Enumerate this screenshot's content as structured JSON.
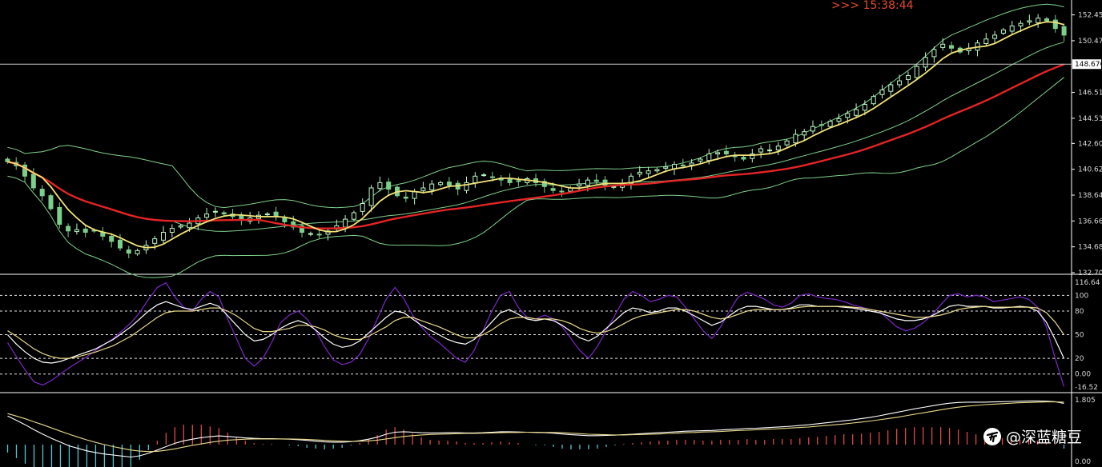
{
  "header": {
    "countdown": ">>> 15:38:44"
  },
  "watermark": {
    "icon": "toutiao-logo-icon",
    "text": "@深蓝糖豆"
  },
  "colors": {
    "background": "#000000",
    "bull_candle": "#b9f7c3",
    "bear_candle": "#7ccf8a",
    "bollinger": "#7fd08a",
    "ma_fast": "#f2e27a",
    "ma_slow": "#e32424",
    "grid": "#e6e6e6",
    "kdj_j": "#7b28c8",
    "kdj_k": "#ffffff",
    "kdj_d": "#e9d98a",
    "macd_pos": "#e04646",
    "macd_neg": "#4fc7d2",
    "countdown": "#e34a2c"
  },
  "chart_data": [
    {
      "type": "candlestick",
      "title": "",
      "ylim": [
        132.705,
        153.1
      ],
      "yticks": [
        "152.450",
        "150.470",
        "146.510",
        "144.530",
        "142.605",
        "140.625",
        "138.645",
        "136.665",
        "134.685",
        "132.705"
      ],
      "current_price": "148.676",
      "grid": false,
      "overlays": [
        "bollinger_upper",
        "bollinger_middle",
        "bollinger_lower",
        "ma_fast",
        "ma_slow"
      ],
      "close_series": [
        141.2,
        140.9,
        140.1,
        139.2,
        138.6,
        137.6,
        136.4,
        135.9,
        136.0,
        135.8,
        135.9,
        135.5,
        135.1,
        134.6,
        134.2,
        134.4,
        134.8,
        135.3,
        135.8,
        136.1,
        136.3,
        136.5,
        136.9,
        137.2,
        137.4,
        137.2,
        137.0,
        136.8,
        136.9,
        137.1,
        137.2,
        137.0,
        136.6,
        136.2,
        135.8,
        135.7,
        135.6,
        135.9,
        136.3,
        136.8,
        137.3,
        138.0,
        139.2,
        139.6,
        139.1,
        138.6,
        138.4,
        138.9,
        139.2,
        139.5,
        139.6,
        139.4,
        139.1,
        139.6,
        140.1,
        140.2,
        140.0,
        139.8,
        139.6,
        139.7,
        139.9,
        139.6,
        139.3,
        139.0,
        138.9,
        139.2,
        139.5,
        139.8,
        139.7,
        139.4,
        139.3,
        139.5,
        140.1,
        140.4,
        140.5,
        140.6,
        140.8,
        141.0,
        140.9,
        141.1,
        141.4,
        141.8,
        141.9,
        141.8,
        141.6,
        141.4,
        141.8,
        142.2,
        142.1,
        142.4,
        142.8,
        143.3,
        143.5,
        143.9,
        144.0,
        144.3,
        144.5,
        144.9,
        145.2,
        145.6,
        146.2,
        146.7,
        147.1,
        147.4,
        147.8,
        148.5,
        149.2,
        149.8,
        150.2,
        149.9,
        149.6,
        149.9,
        150.3,
        150.6,
        150.9,
        151.3,
        151.6,
        151.8,
        152.0,
        152.2,
        152.0,
        151.4,
        150.9
      ]
    },
    {
      "type": "line",
      "title": "",
      "ylim": [
        -16.52,
        116.64
      ],
      "yticks": [
        "116.64",
        "100",
        "80",
        "50",
        "20",
        "0.00",
        "-16.52"
      ],
      "levels": [
        100,
        80,
        50,
        20,
        0
      ],
      "series": [
        {
          "key": "J",
          "color": "#7b28c8",
          "values": [
            40,
            22,
            5,
            -10,
            -14,
            -8,
            0,
            8,
            15,
            22,
            30,
            38,
            45,
            55,
            65,
            78,
            95,
            110,
            116,
            98,
            85,
            80,
            95,
            105,
            98,
            70,
            45,
            20,
            10,
            20,
            40,
            65,
            75,
            80,
            70,
            55,
            35,
            18,
            12,
            15,
            25,
            45,
            70,
            95,
            110,
            96,
            75,
            60,
            48,
            40,
            30,
            20,
            15,
            30,
            55,
            80,
            100,
            105,
            85,
            72,
            70,
            75,
            70,
            60,
            45,
            30,
            20,
            35,
            55,
            75,
            95,
            105,
            100,
            92,
            95,
            100,
            98,
            85,
            70,
            55,
            45,
            60,
            80,
            98,
            104,
            100,
            95,
            88,
            85,
            90,
            100,
            102,
            98,
            96,
            95,
            92,
            88,
            85,
            82,
            80,
            70,
            60,
            55,
            58,
            65,
            75,
            88,
            100,
            102,
            98,
            100,
            98,
            92,
            94,
            96,
            98,
            95,
            85,
            60,
            20,
            -16
          ]
        },
        {
          "key": "K",
          "color": "#ffffff",
          "values": [
            50,
            38,
            28,
            20,
            15,
            14,
            16,
            20,
            24,
            28,
            32,
            38,
            44,
            52,
            60,
            70,
            80,
            88,
            92,
            88,
            84,
            82,
            86,
            90,
            86,
            74,
            62,
            50,
            42,
            44,
            50,
            58,
            64,
            68,
            64,
            56,
            46,
            38,
            34,
            36,
            42,
            52,
            62,
            72,
            80,
            78,
            70,
            62,
            56,
            50,
            44,
            40,
            38,
            44,
            54,
            66,
            78,
            82,
            76,
            70,
            68,
            70,
            68,
            62,
            54,
            46,
            42,
            48,
            58,
            68,
            78,
            84,
            82,
            78,
            80,
            84,
            84,
            80,
            74,
            68,
            62,
            66,
            74,
            82,
            86,
            86,
            84,
            82,
            82,
            84,
            88,
            88,
            86,
            86,
            86,
            85,
            84,
            82,
            80,
            78,
            74,
            70,
            68,
            68,
            70,
            74,
            80,
            86,
            88,
            86,
            86,
            86,
            84,
            84,
            85,
            86,
            85,
            80,
            66,
            44,
            20
          ]
        },
        {
          "key": "D",
          "color": "#e9d98a",
          "values": [
            55,
            48,
            40,
            32,
            26,
            22,
            20,
            20,
            22,
            25,
            28,
            32,
            36,
            42,
            48,
            56,
            64,
            72,
            78,
            80,
            80,
            80,
            82,
            84,
            84,
            80,
            74,
            66,
            58,
            54,
            54,
            56,
            58,
            62,
            62,
            60,
            56,
            50,
            46,
            44,
            44,
            48,
            54,
            60,
            68,
            72,
            72,
            68,
            64,
            60,
            55,
            50,
            46,
            46,
            50,
            56,
            64,
            70,
            72,
            72,
            70,
            70,
            70,
            68,
            64,
            58,
            54,
            52,
            54,
            58,
            64,
            70,
            74,
            76,
            78,
            80,
            82,
            82,
            80,
            76,
            72,
            70,
            72,
            76,
            80,
            82,
            82,
            82,
            82,
            83,
            85,
            86,
            86,
            86,
            86,
            86,
            85,
            84,
            82,
            80,
            78,
            76,
            74,
            72,
            72,
            73,
            75,
            78,
            82,
            84,
            85,
            86,
            85,
            85,
            85,
            85,
            85,
            84,
            78,
            66,
            50
          ]
        }
      ]
    },
    {
      "type": "line",
      "title": "",
      "ylim": [
        0,
        1.805
      ],
      "yticks": [
        "1.805",
        "0.00"
      ],
      "series": [
        {
          "key": "MACD",
          "color": "#ffffff",
          "values": [
            1.15,
            0.98,
            0.8,
            0.6,
            0.42,
            0.25,
            0.1,
            -0.05,
            -0.15,
            -0.25,
            -0.32,
            -0.38,
            -0.42,
            -0.46,
            -0.5,
            -0.45,
            -0.35,
            -0.22,
            -0.08,
            0.05,
            0.15,
            0.22,
            0.28,
            0.32,
            0.35,
            0.33,
            0.3,
            0.27,
            0.25,
            0.24,
            0.24,
            0.23,
            0.22,
            0.2,
            0.17,
            0.14,
            0.11,
            0.1,
            0.1,
            0.12,
            0.16,
            0.22,
            0.3,
            0.42,
            0.5,
            0.52,
            0.5,
            0.48,
            0.47,
            0.47,
            0.48,
            0.48,
            0.47,
            0.47,
            0.48,
            0.5,
            0.52,
            0.52,
            0.51,
            0.5,
            0.49,
            0.48,
            0.46,
            0.43,
            0.4,
            0.38,
            0.36,
            0.36,
            0.37,
            0.38,
            0.4,
            0.42,
            0.44,
            0.46,
            0.48,
            0.5,
            0.52,
            0.54,
            0.55,
            0.56,
            0.57,
            0.59,
            0.61,
            0.63,
            0.65,
            0.66,
            0.68,
            0.7,
            0.72,
            0.74,
            0.77,
            0.8,
            0.84,
            0.88,
            0.92,
            0.96,
            1.0,
            1.05,
            1.1,
            1.16,
            1.23,
            1.3,
            1.37,
            1.44,
            1.5,
            1.56,
            1.62,
            1.67,
            1.7,
            1.71,
            1.71,
            1.71,
            1.72,
            1.73,
            1.74,
            1.75,
            1.76,
            1.76,
            1.75,
            1.73,
            1.66
          ]
        },
        {
          "key": "Signal",
          "color": "#e9d98a",
          "values": [
            1.25,
            1.15,
            1.04,
            0.92,
            0.8,
            0.67,
            0.54,
            0.42,
            0.3,
            0.19,
            0.09,
            0.0,
            -0.08,
            -0.15,
            -0.22,
            -0.26,
            -0.28,
            -0.27,
            -0.23,
            -0.17,
            -0.1,
            -0.03,
            0.03,
            0.09,
            0.14,
            0.18,
            0.2,
            0.22,
            0.23,
            0.23,
            0.23,
            0.23,
            0.23,
            0.22,
            0.21,
            0.19,
            0.17,
            0.15,
            0.14,
            0.13,
            0.14,
            0.15,
            0.18,
            0.23,
            0.28,
            0.33,
            0.36,
            0.39,
            0.41,
            0.42,
            0.43,
            0.44,
            0.45,
            0.45,
            0.46,
            0.47,
            0.48,
            0.49,
            0.49,
            0.5,
            0.5,
            0.49,
            0.49,
            0.48,
            0.46,
            0.44,
            0.42,
            0.41,
            0.4,
            0.39,
            0.39,
            0.4,
            0.41,
            0.42,
            0.43,
            0.45,
            0.46,
            0.48,
            0.49,
            0.51,
            0.52,
            0.53,
            0.55,
            0.57,
            0.58,
            0.6,
            0.62,
            0.63,
            0.65,
            0.67,
            0.69,
            0.71,
            0.74,
            0.77,
            0.8,
            0.83,
            0.87,
            0.91,
            0.95,
            1.0,
            1.05,
            1.1,
            1.16,
            1.22,
            1.28,
            1.34,
            1.4,
            1.46,
            1.51,
            1.55,
            1.58,
            1.61,
            1.63,
            1.65,
            1.67,
            1.69,
            1.7,
            1.71,
            1.72,
            1.72,
            1.71
          ]
        }
      ]
    }
  ]
}
